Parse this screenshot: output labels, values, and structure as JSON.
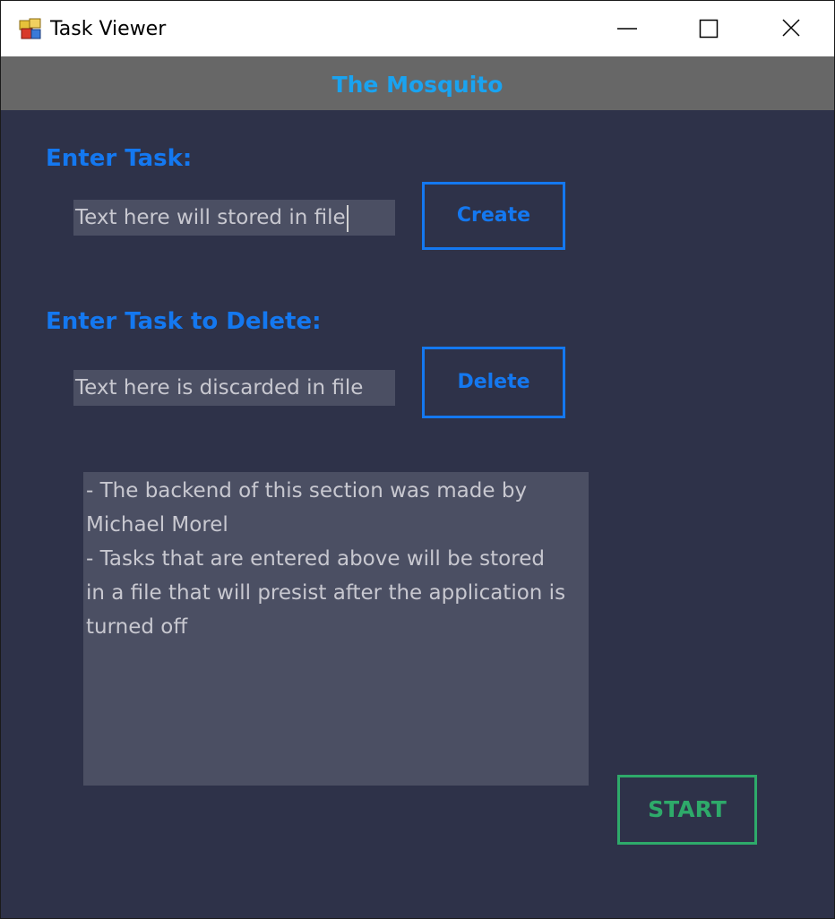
{
  "window": {
    "title": "Task Viewer",
    "controls": {
      "minimize_icon": "minimize-icon",
      "maximize_icon": "maximize-icon",
      "close_icon": "close-icon"
    }
  },
  "header": {
    "title": "The Mosquito"
  },
  "create_section": {
    "label": "Enter Task:",
    "input_value": "Text here will stored in file",
    "button_label": "Create"
  },
  "delete_section": {
    "label": "Enter Task to Delete:",
    "input_value": "Text here is discarded in file",
    "button_label": "Delete"
  },
  "info": {
    "lines": [
      "- The backend of this section was made by",
      "Michael Morel",
      "- Tasks that are entered above will be stored",
      "in a file that will presist after the application is",
      "turned off"
    ]
  },
  "start_button": {
    "label": "START"
  },
  "colors": {
    "background": "#2e3249",
    "header_bar": "#676767",
    "header_text": "#1aa3f0",
    "accent_blue": "#1478f0",
    "accent_green": "#2eaa6a",
    "input_bg": "#4b4f63",
    "input_text": "#c8c8d0"
  }
}
